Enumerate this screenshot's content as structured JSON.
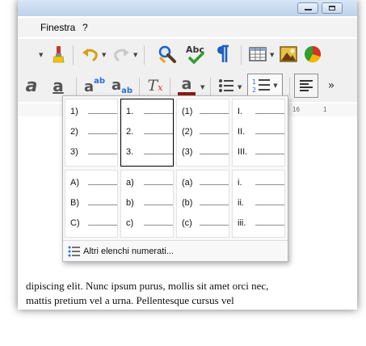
{
  "menubar": {
    "items": [
      "Finestra",
      "?"
    ]
  },
  "toolbar": {
    "buttons": [
      "clone-formatting",
      "undo",
      "redo",
      "find-replace",
      "spelling",
      "formatting-marks",
      "insert-table",
      "insert-image",
      "insert-chart"
    ]
  },
  "format_toolbar": {
    "buttons": [
      "italic",
      "underline",
      "superscript",
      "subscript",
      "clear-formatting",
      "font-color",
      "bullets",
      "numbering",
      "align-left",
      "more"
    ],
    "font_color": "#8b1a1a",
    "accent": "#2a6fd8",
    "subscript_glyph": "ab",
    "superscript_glyph": "ab"
  },
  "ruler": {
    "numbers": [
      "16",
      "1"
    ]
  },
  "numbering_panel": {
    "presets": [
      [
        "1)",
        "2)",
        "3)"
      ],
      [
        "1.",
        "2.",
        "3."
      ],
      [
        "(1)",
        "(2)",
        "(3)"
      ],
      [
        "I.",
        "II.",
        "III."
      ],
      [
        "A)",
        "B)",
        "C)"
      ],
      [
        "a)",
        "b)",
        "c)"
      ],
      [
        "(a)",
        "(b)",
        "(c)"
      ],
      [
        "i.",
        "ii.",
        "iii."
      ]
    ],
    "selected_index": 1,
    "more_label": "Altri elenchi numerati..."
  },
  "document": {
    "lines": [
      "dipiscing elit. Nunc ipsum purus, mollis sit amet orci nec,",
      "mattis pretium vel a urna. Pellentesque cursus vel"
    ]
  }
}
